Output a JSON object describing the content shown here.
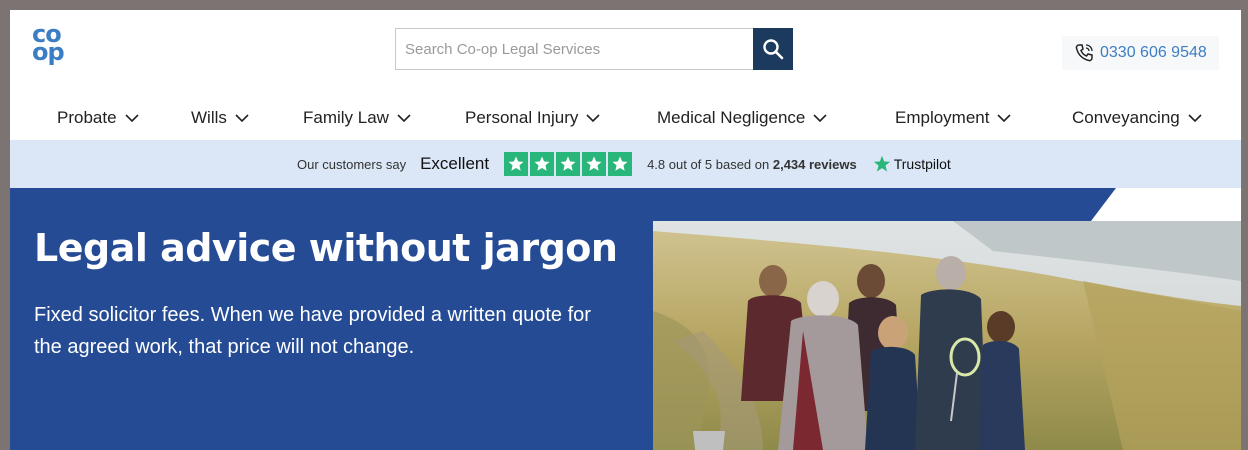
{
  "header": {
    "logo_line1": "co",
    "logo_line2": "op",
    "search_placeholder": "Search Co-op Legal Services",
    "phone": "0330 606 9548"
  },
  "nav": {
    "items": [
      {
        "label": "Probate"
      },
      {
        "label": "Wills"
      },
      {
        "label": "Family Law"
      },
      {
        "label": "Personal Injury"
      },
      {
        "label": "Medical Negligence"
      },
      {
        "label": "Employment"
      },
      {
        "label": "Conveyancing"
      }
    ]
  },
  "trust": {
    "prefix": "Our customers say",
    "rating_word": "Excellent",
    "stars": 5,
    "score_text": "4.8 out of 5 based on",
    "review_count": "2,434 reviews",
    "brand": "Trustpilot",
    "star_color": "#28b67a"
  },
  "hero": {
    "title": "Legal advice without jargon",
    "subtitle": "Fixed solicitor fees. When we have provided a written quote for the agreed work, that price will not change.",
    "bg_color": "#254b94"
  },
  "colors": {
    "brand_blue": "#3c7ec4",
    "search_button": "#1c3a5e",
    "trust_bar": "#dbe7f6"
  }
}
